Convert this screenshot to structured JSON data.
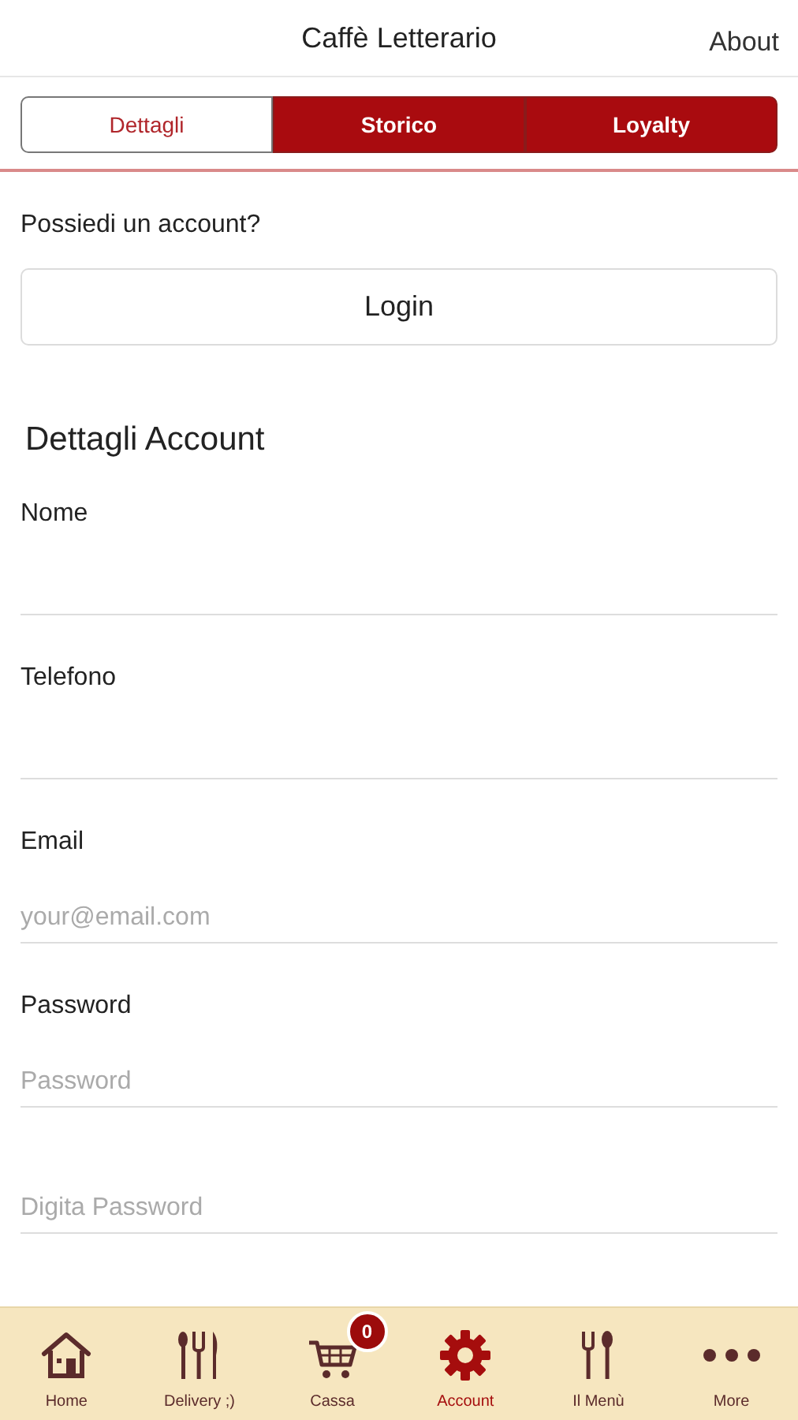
{
  "header": {
    "title": "Caffè Letterario",
    "action": "About"
  },
  "tabs": [
    {
      "label": "Dettagli",
      "selected": true
    },
    {
      "label": "Storico",
      "selected": false
    },
    {
      "label": "Loyalty",
      "selected": false
    }
  ],
  "account_prompt": "Possiedi un account?",
  "login_button": "Login",
  "section_title": "Dettagli Account",
  "fields": [
    {
      "label": "Nome"
    },
    {
      "label": "Telefono"
    },
    {
      "label": "Email",
      "placeholder": "your@email.com"
    },
    {
      "label": "Password",
      "placeholder": "Password"
    },
    {
      "placeholder": "Digita Password"
    }
  ],
  "nav": [
    {
      "label": "Home",
      "selected": false
    },
    {
      "label": "Delivery ;)",
      "selected": false
    },
    {
      "label": "Cassa",
      "selected": false,
      "badge": "0"
    },
    {
      "label": "Account",
      "selected": true
    },
    {
      "label": "Il Menù",
      "selected": false
    },
    {
      "label": "More",
      "selected": false
    }
  ]
}
